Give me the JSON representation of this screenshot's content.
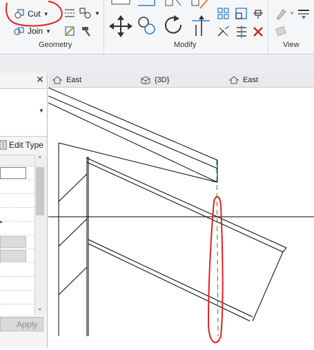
{
  "ribbon": {
    "cut_label": "Cut",
    "join_label": "Join",
    "panels": {
      "geometry": "Geometry",
      "modify": "Modify",
      "view": "View"
    }
  },
  "view_tabs": [
    {
      "label": "East",
      "icon": "elevation-house-icon"
    },
    {
      "label": "{3D}",
      "icon": "3d-view-icon"
    },
    {
      "label": "East",
      "icon": "elevation-house-icon"
    }
  ],
  "properties": {
    "close_glyph": "✕",
    "edit_type_label": "Edit Type",
    "apply_label": "Apply"
  },
  "annotation_color": "#e02020",
  "accent": "#2f7fd0"
}
